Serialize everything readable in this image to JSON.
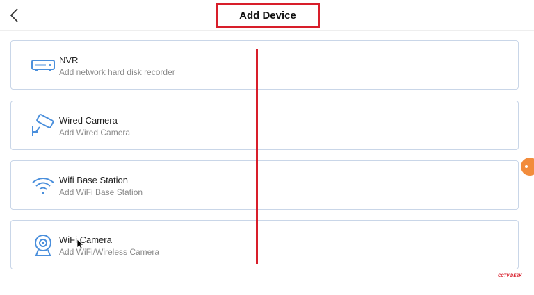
{
  "header": {
    "title": "Add Device"
  },
  "devices": [
    {
      "name": "NVR",
      "description": "Add network hard disk recorder",
      "icon": "nvr-icon"
    },
    {
      "name": "Wired Camera",
      "description": "Add Wired Camera",
      "icon": "wired-camera-icon"
    },
    {
      "name": "Wifi Base Station",
      "description": "Add WiFi Base Station",
      "icon": "wifi-icon"
    },
    {
      "name": "WiFi Camera",
      "description": "Add WiFi/Wireless Camera",
      "icon": "webcam-icon"
    }
  ],
  "watermark": "CCTV DESK",
  "colors": {
    "accent": "#4a8fdc",
    "highlight": "#d81e2a",
    "card_border": "#c9d6e8"
  }
}
